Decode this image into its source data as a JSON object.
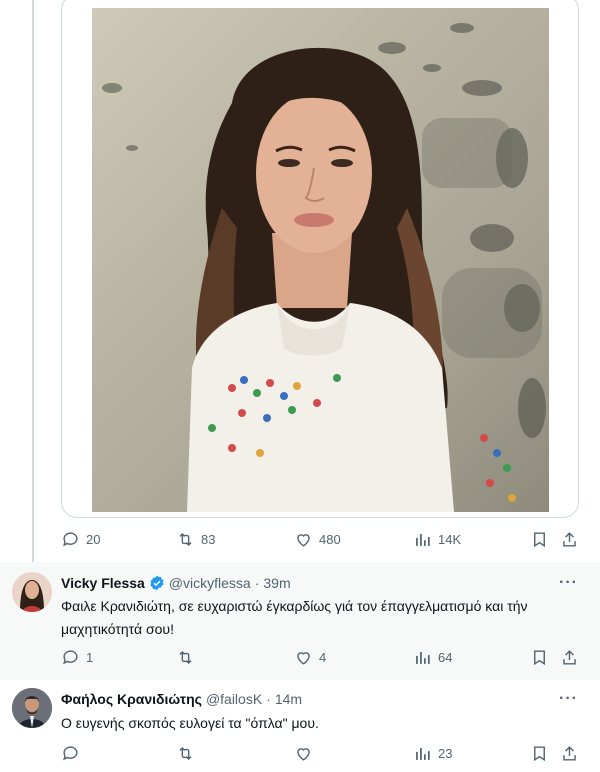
{
  "top_tweet": {
    "actions": {
      "replies": "20",
      "retweets": "83",
      "likes": "480",
      "views": "14K"
    }
  },
  "reply1": {
    "name": "Vicky Flessa",
    "handle": "@vickyflessa",
    "dot": "·",
    "time": "39m",
    "more": "···",
    "text": "Φαιλε Κρανιδιώτη, σε ευχαριστώ έγκαρδίως γιά τον έπαγγελματισμό και τήν μαχητικότητά σου!",
    "actions": {
      "replies": "1",
      "retweets": "",
      "likes": "4",
      "views": "64"
    }
  },
  "reply2": {
    "name": "Φαήλος Κρανιδιώτης",
    "handle": "@failosK",
    "dot": "·",
    "time": "14m",
    "more": "···",
    "text": "Ο ευγενής σκοπός ευλογεί τα \"όπλα\" μου.",
    "actions": {
      "replies": "",
      "retweets": "",
      "likes": "",
      "views": "23"
    }
  },
  "colors": {
    "accent": "#1d9bf0",
    "muted": "#536471",
    "border": "#cfd9de",
    "gray_bg": "#f7f9f9"
  },
  "icons": [
    "reply-icon",
    "retweet-icon",
    "like-icon",
    "views-icon",
    "bookmark-icon",
    "share-icon",
    "verified-badge-icon",
    "more-icon"
  ]
}
